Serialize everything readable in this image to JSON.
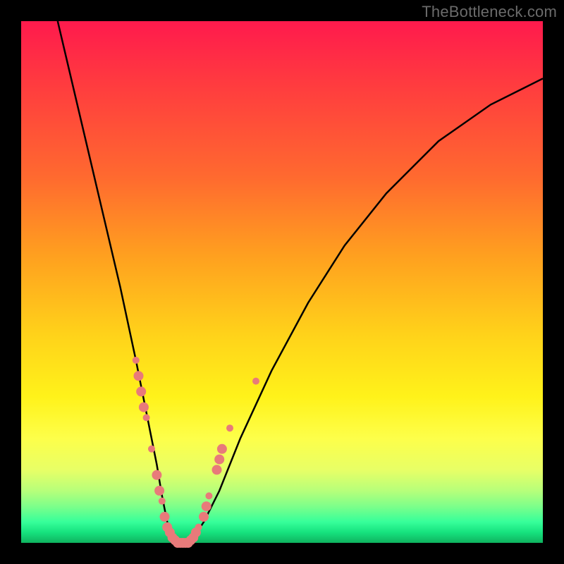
{
  "watermark": "TheBottleneck.com",
  "colors": {
    "dot": "#e87a7a",
    "curve": "#000000",
    "frame": "#000000"
  },
  "chart_data": {
    "type": "line",
    "title": "",
    "xlabel": "",
    "ylabel": "",
    "xlim": [
      0,
      100
    ],
    "ylim": [
      0,
      100
    ],
    "grid": false,
    "legend": false,
    "notes": "V-shaped bottleneck curve; no axis ticks or labels shown. Values are estimated from the plotted black curve against the 740×740 plot area. Lower values = closer to bottom (green band).",
    "series": [
      {
        "name": "bottleneck-curve",
        "x": [
          7,
          11,
          15,
          19,
          22,
          24,
          26,
          27,
          28,
          29,
          30,
          32,
          33,
          35,
          38,
          42,
          48,
          55,
          62,
          70,
          80,
          90,
          100
        ],
        "y": [
          100,
          83,
          66,
          49,
          35,
          25,
          15,
          9,
          4,
          1,
          0,
          0,
          1,
          4,
          10,
          20,
          33,
          46,
          57,
          67,
          77,
          84,
          89
        ]
      }
    ],
    "scatter_points": {
      "name": "highlighted-points",
      "comment": "Pink dots overlaid on the curve near the valley. (x, y, radius_scale) — radius_scale 1 = small, 2 = medium, 3 = large/cluster.",
      "points": [
        [
          22,
          35,
          1
        ],
        [
          22.5,
          32,
          2
        ],
        [
          23,
          29,
          2
        ],
        [
          23.5,
          26,
          2
        ],
        [
          24,
          24,
          1
        ],
        [
          25,
          18,
          1
        ],
        [
          26,
          13,
          2
        ],
        [
          26.5,
          10,
          2
        ],
        [
          27,
          8,
          1
        ],
        [
          27.5,
          5,
          2
        ],
        [
          28,
          3,
          2
        ],
        [
          28.5,
          2,
          2
        ],
        [
          29,
          1,
          2
        ],
        [
          29.5,
          0.5,
          2
        ],
        [
          30,
          0,
          2
        ],
        [
          30.5,
          0,
          2
        ],
        [
          31,
          0,
          2
        ],
        [
          31.5,
          0,
          2
        ],
        [
          32,
          0,
          2
        ],
        [
          32.5,
          0.5,
          2
        ],
        [
          33,
          1,
          2
        ],
        [
          33.5,
          2,
          2
        ],
        [
          34,
          3,
          1
        ],
        [
          35,
          5,
          2
        ],
        [
          35.5,
          7,
          2
        ],
        [
          36,
          9,
          1
        ],
        [
          37.5,
          14,
          2
        ],
        [
          38,
          16,
          2
        ],
        [
          38.5,
          18,
          2
        ],
        [
          40,
          22,
          1
        ],
        [
          45,
          31,
          1
        ]
      ]
    }
  }
}
